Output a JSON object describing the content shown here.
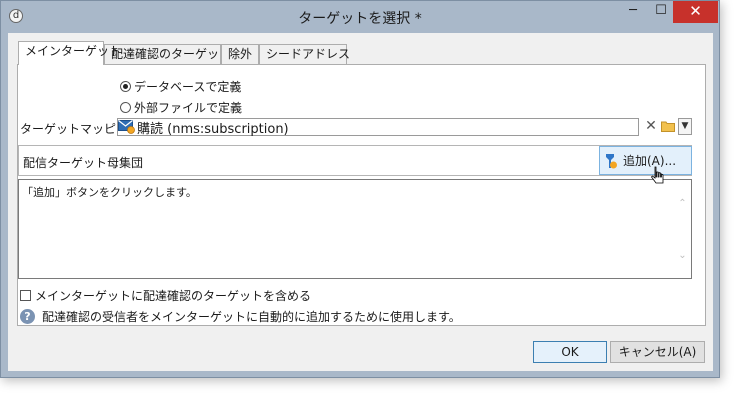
{
  "window": {
    "title": "ターゲットを選択 *",
    "app_icon_glyph": "d",
    "minimize_glyph": "─",
    "maximize_glyph": "☐",
    "close_glyph": "✕"
  },
  "tabs": [
    {
      "label": "メインターゲット",
      "active": true
    },
    {
      "label": "配達確認のターゲット",
      "active": false
    },
    {
      "label": "除外",
      "active": false
    },
    {
      "label": "シードアドレス",
      "active": false
    }
  ],
  "source": {
    "option_database": "データベースで定義",
    "option_file": "外部ファイルで定義",
    "selected": "database"
  },
  "mapping": {
    "label": "ターゲットマッピング:",
    "value": "購読 (nms:subscription)",
    "clear_glyph": "✕",
    "dropdown_glyph": "▼"
  },
  "population": {
    "label": "配信ターゲット母集団",
    "add_button": "追加(A)...",
    "message": "「追加」ボタンをクリックします。",
    "scroll_up_glyph": "⌃",
    "scroll_down_glyph": "⌄"
  },
  "include_proof": {
    "label": "メインターゲットに配達確認のターゲットを含める",
    "checked": false
  },
  "info": {
    "glyph": "?",
    "text": "配達確認の受信者をメインターゲットに自動的に追加するために使用します。"
  },
  "buttons": {
    "ok": "OK",
    "cancel": "キャンセル(A)"
  },
  "colors": {
    "window_frame": "#a9b8c9",
    "close_button": "#c7312b",
    "add_button_bg": "#e3f0fb",
    "add_button_border": "#7cb3e0",
    "info_icon": "#7b93b3",
    "ok_border": "#3c7fb1"
  }
}
